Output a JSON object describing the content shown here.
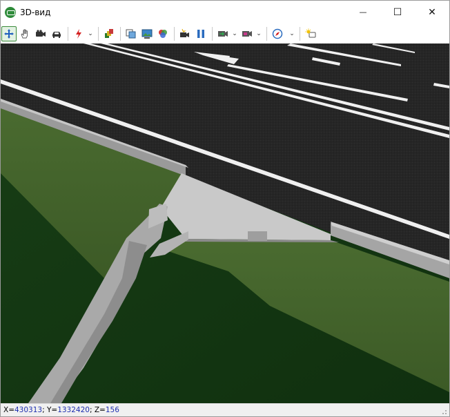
{
  "window": {
    "title": "3D-вид",
    "minimize": "—",
    "maximize": "☐",
    "close": "✕"
  },
  "toolbar": {
    "tools": [
      {
        "name": "move-tool-icon",
        "active": true
      },
      {
        "name": "pan-hand-icon"
      },
      {
        "name": "camera-icon"
      },
      {
        "name": "car-icon"
      },
      {
        "name": "lightning-icon",
        "dropdown": true
      },
      {
        "name": "paint-layers-icon"
      },
      {
        "name": "copy-view-icon"
      },
      {
        "name": "screenshot-icon"
      },
      {
        "name": "render-icon"
      },
      {
        "name": "record-icon"
      },
      {
        "name": "pause-icon"
      },
      {
        "name": "video-export-icon",
        "dropdown": true
      },
      {
        "name": "save-video-icon",
        "dropdown": true
      },
      {
        "name": "compass-icon",
        "dropdown": true
      },
      {
        "name": "light-settings-icon"
      }
    ],
    "accent": "#3a8a3a"
  },
  "status": {
    "x_label": "X=",
    "x": "430313",
    "y_label": "; Y=",
    "y": "1332420",
    "z_label": "; Z=",
    "z": "156"
  }
}
